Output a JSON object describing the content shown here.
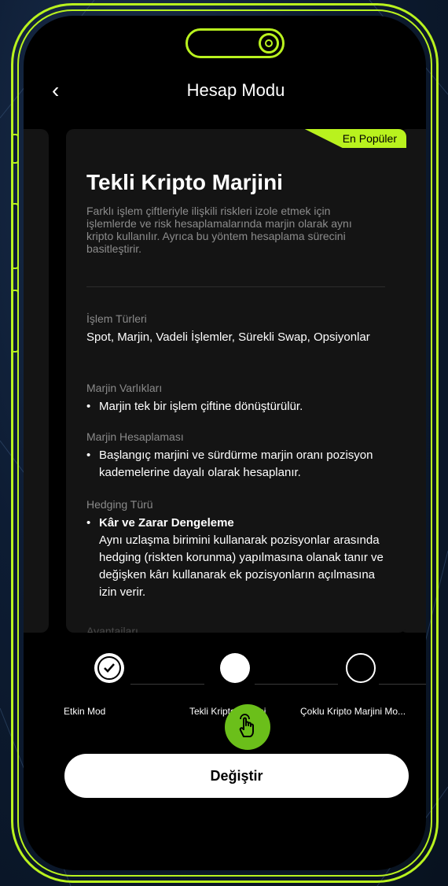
{
  "header": {
    "title": "Hesap Modu",
    "back_icon": "chevron-left-icon"
  },
  "card": {
    "badge": "En Popüler",
    "title": "Tekli Kripto Marjini",
    "description": "Farklı işlem çiftleriyle ilişkili riskleri izole etmek için işlemlerde ve risk hesaplamalarında marjin olarak aynı kripto kullanılır. Ayrıca bu yöntem hesaplama sürecini basitleştirir.",
    "sections": {
      "trade_types": {
        "label": "İşlem Türleri",
        "value": "Spot, Marjin, Vadeli İşlemler, Sürekli Swap, Opsiyonlar"
      },
      "margin_assets": {
        "label": "Marjin Varlıkları",
        "bullet": "Marjin tek bir işlem çiftine dönüştürülür."
      },
      "margin_calc": {
        "label": "Marjin Hesaplaması",
        "bullet": "Başlangıç marjini ve sürdürme marjin oranı pozisyon kademelerine dayalı olarak hesaplanır."
      },
      "hedging": {
        "label": "Hedging Türü",
        "bullet_title": "Kâr ve Zarar Dengeleme",
        "bullet_text": "Aynı uzlaşma birimini kullanarak pozisyonlar arasında hedging (riskten korunma) yapılmasına olanak tanır ve değişken kârı kullanarak ek pozisyonların açılmasına izin verir."
      },
      "advantages_label": "Avantajları"
    }
  },
  "steps": [
    {
      "label": "Etkin Mod",
      "state": "checked"
    },
    {
      "label": "Tekli Kripto Marjini",
      "state": "selected"
    },
    {
      "label": "Çoklu Kripto Marjini Mo...",
      "state": "empty"
    }
  ],
  "action": {
    "label": "Değiştir"
  },
  "colors": {
    "accent": "#b9f21e",
    "hand": "#6bbf1a",
    "card": "#141414"
  }
}
